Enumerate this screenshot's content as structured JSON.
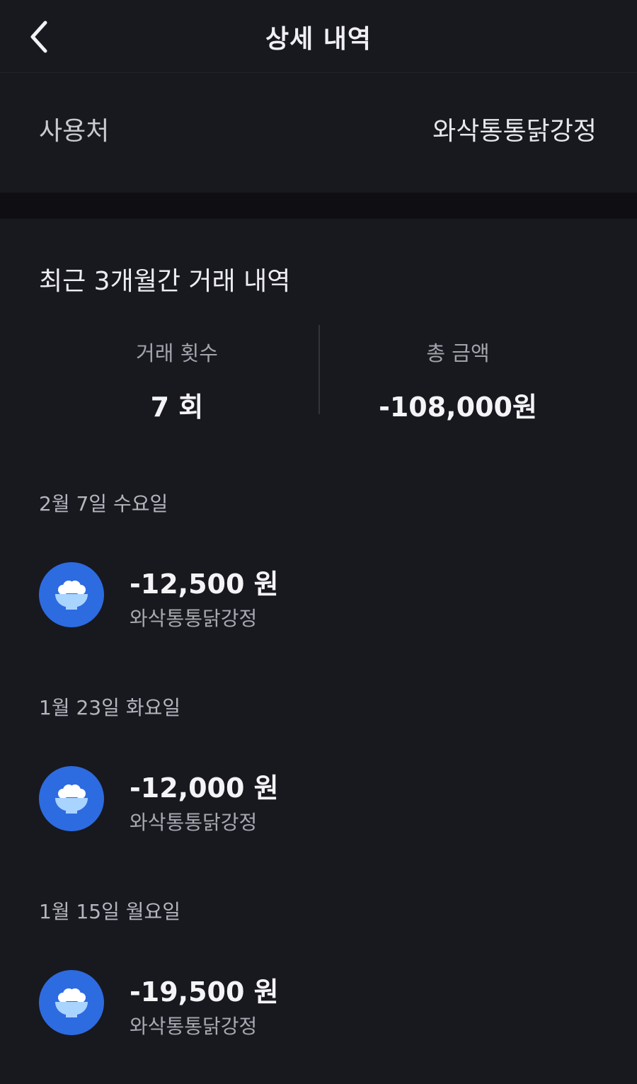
{
  "header": {
    "title": "상세 내역",
    "back_icon": "chevron-left-icon"
  },
  "merchant_row": {
    "label": "사용처",
    "value": "와삭통통닭강정"
  },
  "summary": {
    "heading": "최근 3개월간 거래 내역",
    "count_label": "거래 횟수",
    "count_value": "7 회",
    "total_label": "총 금액",
    "total_value": "-108,000원"
  },
  "transactions": [
    {
      "date": "2월 7일 수요일",
      "amount": "-12,500 원",
      "merchant": "와삭통통닭강정",
      "icon": "rice-bowl-icon"
    },
    {
      "date": "1월 23일 화요일",
      "amount": "-12,000 원",
      "merchant": "와삭통통닭강정",
      "icon": "rice-bowl-icon"
    },
    {
      "date": "1월 15일 월요일",
      "amount": "-19,500 원",
      "merchant": "와삭통통닭강정",
      "icon": "rice-bowl-icon"
    }
  ],
  "colors": {
    "background": "#18181f",
    "separator": "#0f0f13",
    "icon_bg": "#2d6be0",
    "text_primary": "#f4f4f7",
    "text_secondary": "#a8a8b2"
  }
}
